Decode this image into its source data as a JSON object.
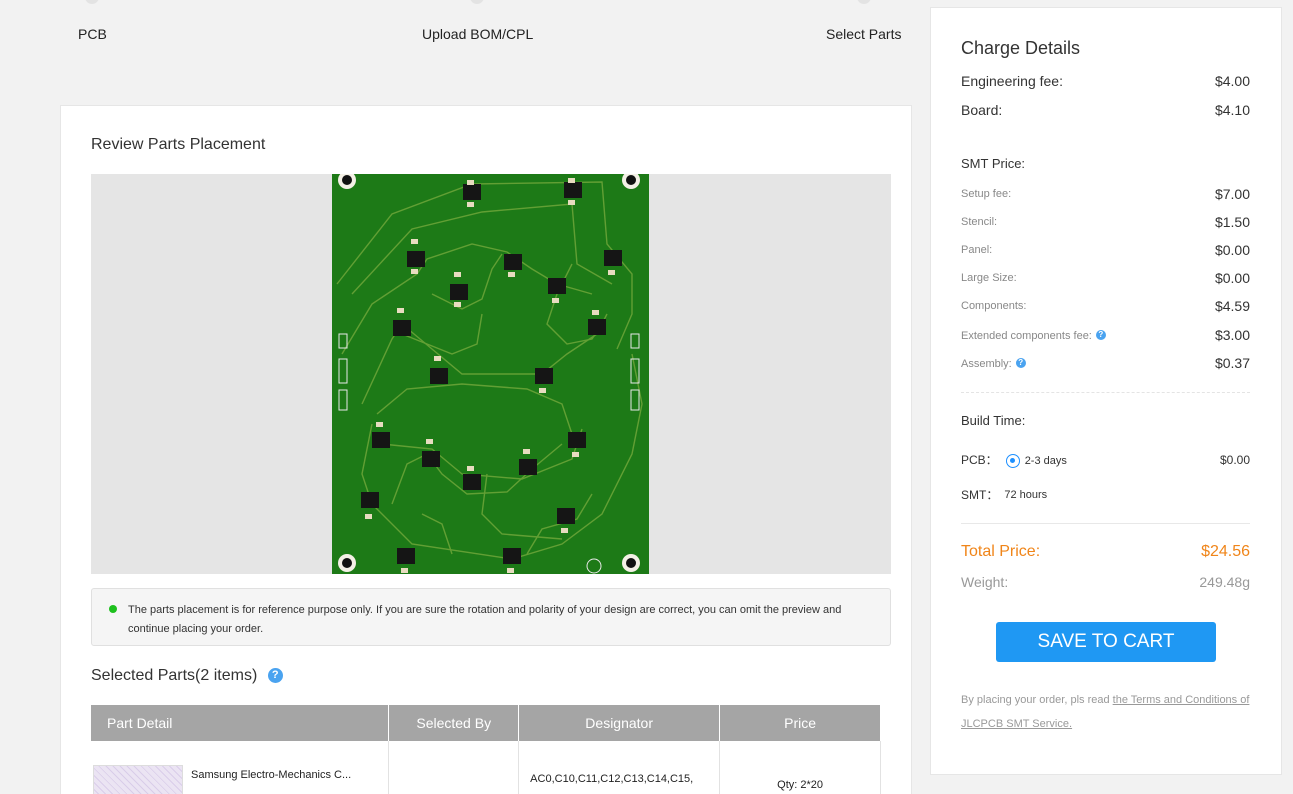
{
  "steps": [
    {
      "label": "PCB"
    },
    {
      "label": "Upload BOM/CPL"
    },
    {
      "label": "Select Parts"
    }
  ],
  "review": {
    "title": "Review Parts Placement",
    "notice": "The parts placement is for reference purpose only. If you are sure the rotation and polarity of your design are correct, you can omit the preview and continue placing your order."
  },
  "selected_parts": {
    "title": "Selected Parts(2 items)",
    "help_icon": "?",
    "columns": [
      "Part Detail",
      "Selected By",
      "Designator",
      "Price"
    ],
    "rows": [
      {
        "part": "Samsung Electro-Mechanics C...",
        "selected_by": "",
        "designator": "AC0,C10,C11,C12,C13,C14,C15,",
        "price": "Qty: 2*20"
      }
    ]
  },
  "charge": {
    "title": "Charge Details",
    "engineering_fee_label": "Engineering fee:",
    "engineering_fee": "$4.00",
    "board_label": "Board:",
    "board": "$4.10",
    "smt_heading": "SMT Price:",
    "smt_items": [
      {
        "label": "Setup fee:",
        "value": "$7.00"
      },
      {
        "label": "Stencil:",
        "value": "$1.50"
      },
      {
        "label": "Panel:",
        "value": "$0.00"
      },
      {
        "label": "Large Size:",
        "value": "$0.00"
      },
      {
        "label": "Components:",
        "value": "$4.59"
      },
      {
        "label": "Extended components fee:",
        "value": "$3.00"
      },
      {
        "label": "Assembly:",
        "value": "$0.37"
      }
    ],
    "build_time_heading": "Build Time:",
    "pcb_label": "PCB：",
    "pcb_option": "2-3 days",
    "pcb_option_price": "$0.00",
    "smt_label": "SMT：",
    "smt_time": "72 hours",
    "total_label": "Total Price:",
    "total": "$24.56",
    "weight_label": "Weight:",
    "weight": "249.48g",
    "save_button": "SAVE TO CART",
    "terms_prefix": "By placing your order, pls read ",
    "terms_link": "the Terms and Conditions of JLCPCB SMT Service."
  },
  "colors": {
    "accent": "#1f98f3",
    "total": "#f08519",
    "board_green": "#1d7a17",
    "notice_dot": "#1ec01e"
  },
  "icons": [
    "help-icon",
    "radio-selected-icon",
    "status-dot-icon"
  ]
}
